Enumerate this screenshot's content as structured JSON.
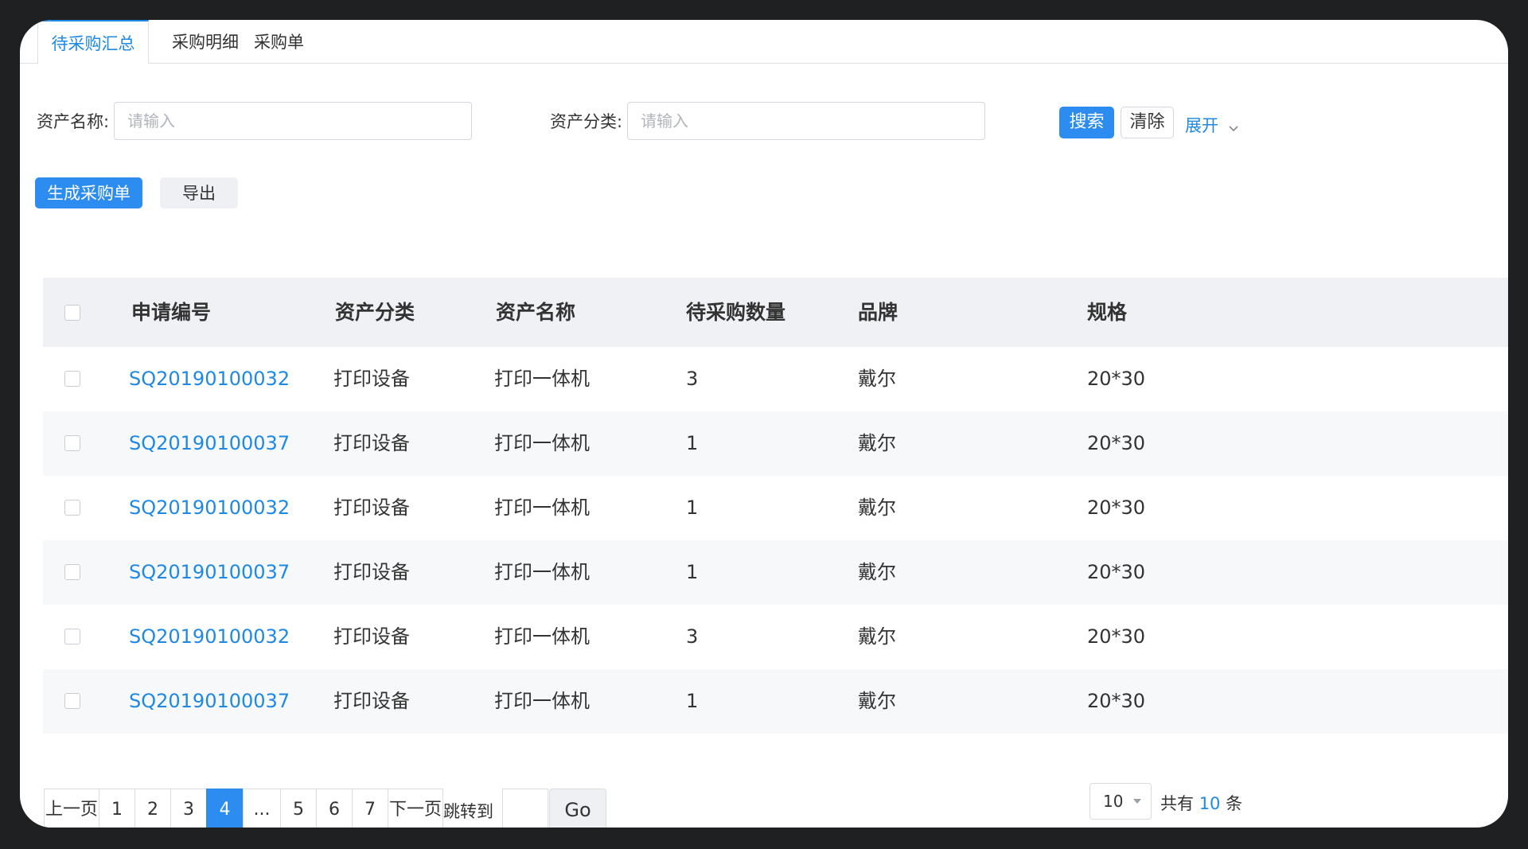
{
  "tabs": [
    "待采购汇总",
    "采购明细",
    "采购单"
  ],
  "search": {
    "asset_name_label": "资产名称:",
    "asset_name_placeholder": "请输入",
    "asset_category_label": "资产分类:",
    "asset_category_placeholder": "请输入",
    "search_button": "搜索",
    "clear_button": "清除",
    "expand_link": "展开"
  },
  "actions": {
    "generate_order": "生成采购单",
    "export": "导出"
  },
  "table": {
    "columns": [
      "申请编号",
      "资产分类",
      "资产名称",
      "待采购数量",
      "品牌",
      "规格"
    ],
    "rows": [
      {
        "id": "SQ20190100032",
        "category": "打印设备",
        "name": "打印一体机",
        "qty": "3",
        "brand": "戴尔",
        "spec": "20*30"
      },
      {
        "id": "SQ20190100037",
        "category": "打印设备",
        "name": "打印一体机",
        "qty": "1",
        "brand": "戴尔",
        "spec": "20*30"
      },
      {
        "id": "SQ20190100032",
        "category": "打印设备",
        "name": "打印一体机",
        "qty": "1",
        "brand": "戴尔",
        "spec": "20*30"
      },
      {
        "id": "SQ20190100037",
        "category": "打印设备",
        "name": "打印一体机",
        "qty": "1",
        "brand": "戴尔",
        "spec": "20*30"
      },
      {
        "id": "SQ20190100032",
        "category": "打印设备",
        "name": "打印一体机",
        "qty": "3",
        "brand": "戴尔",
        "spec": "20*30"
      },
      {
        "id": "SQ20190100037",
        "category": "打印设备",
        "name": "打印一体机",
        "qty": "1",
        "brand": "戴尔",
        "spec": "20*30"
      }
    ]
  },
  "pagination": {
    "prev": "上一页",
    "pages": [
      "1",
      "2",
      "3",
      "4",
      "...",
      "5",
      "6",
      "7"
    ],
    "current": "4",
    "next": "下一页",
    "jump_label": "跳转到",
    "go": "Go",
    "page_size": "10",
    "total_prefix": "共有",
    "total_count": "10",
    "total_suffix": "条"
  },
  "colors": {
    "primary": "#2d8cf0",
    "link": "#1e88e5",
    "header_bg": "#eff1f5",
    "stripe_bg": "#f7f8fa"
  }
}
